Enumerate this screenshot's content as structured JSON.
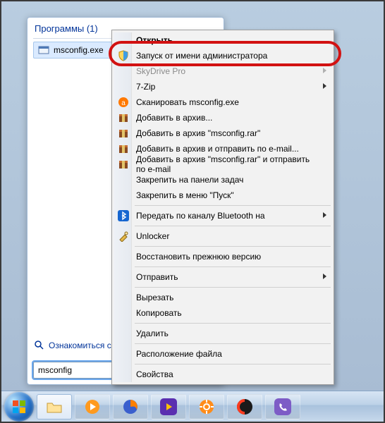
{
  "start_menu": {
    "programs_header": "Программы (1)",
    "program_item": {
      "label": "msconfig.exe"
    },
    "learn_more": "Ознакомиться с",
    "search_value": "msconfig"
  },
  "context_menu": {
    "items": [
      {
        "label": "Открыть",
        "bold": true,
        "icon": null,
        "submenu": false,
        "disabled": false
      },
      {
        "label": "Запуск от имени администратора",
        "icon": "shield-icon",
        "submenu": false,
        "disabled": false
      },
      {
        "label": "SkyDrive Pro",
        "icon": null,
        "submenu": true,
        "disabled": true
      },
      {
        "label": "7-Zip",
        "icon": null,
        "submenu": true,
        "disabled": false
      },
      {
        "label": "Сканировать msconfig.exe",
        "icon": "avast-icon",
        "submenu": false,
        "disabled": false
      },
      {
        "label": "Добавить в архив...",
        "icon": "winrar-icon",
        "submenu": false,
        "disabled": false
      },
      {
        "label": "Добавить в архив \"msconfig.rar\"",
        "icon": "winrar-icon",
        "submenu": false,
        "disabled": false
      },
      {
        "label": "Добавить в архив и отправить по e-mail...",
        "icon": "winrar-icon",
        "submenu": false,
        "disabled": false
      },
      {
        "label": "Добавить в архив \"msconfig.rar\" и отправить по e-mail",
        "icon": "winrar-icon",
        "submenu": false,
        "disabled": false
      },
      {
        "label": "Закрепить на панели задач",
        "icon": null,
        "submenu": false,
        "disabled": false
      },
      {
        "label": "Закрепить в меню \"Пуск\"",
        "icon": null,
        "submenu": false,
        "disabled": false
      },
      {
        "sep": true
      },
      {
        "label": "Передать по каналу Bluetooth на",
        "icon": "bluetooth-icon",
        "submenu": true,
        "disabled": false
      },
      {
        "sep": true
      },
      {
        "label": "Unlocker",
        "icon": "unlocker-icon",
        "submenu": false,
        "disabled": false
      },
      {
        "sep": true
      },
      {
        "label": "Восстановить прежнюю версию",
        "icon": null,
        "submenu": false,
        "disabled": false
      },
      {
        "sep": true
      },
      {
        "label": "Отправить",
        "icon": null,
        "submenu": true,
        "disabled": false
      },
      {
        "sep": true
      },
      {
        "label": "Вырезать",
        "icon": null,
        "submenu": false,
        "disabled": false
      },
      {
        "label": "Копировать",
        "icon": null,
        "submenu": false,
        "disabled": false
      },
      {
        "sep": true
      },
      {
        "label": "Удалить",
        "icon": null,
        "submenu": false,
        "disabled": false
      },
      {
        "sep": true
      },
      {
        "label": "Расположение файла",
        "icon": null,
        "submenu": false,
        "disabled": false
      },
      {
        "sep": true
      },
      {
        "label": "Свойства",
        "icon": null,
        "submenu": false,
        "disabled": false
      }
    ]
  },
  "taskbar": {
    "buttons": [
      {
        "name": "start-orb"
      },
      {
        "name": "explorer",
        "active": true
      },
      {
        "name": "wmplayer"
      },
      {
        "name": "firefox"
      },
      {
        "name": "media-purple"
      },
      {
        "name": "settings-orange"
      },
      {
        "name": "ccleaner"
      },
      {
        "name": "viber"
      }
    ]
  },
  "colors": {
    "highlight": "#d21212",
    "link": "#003399"
  }
}
